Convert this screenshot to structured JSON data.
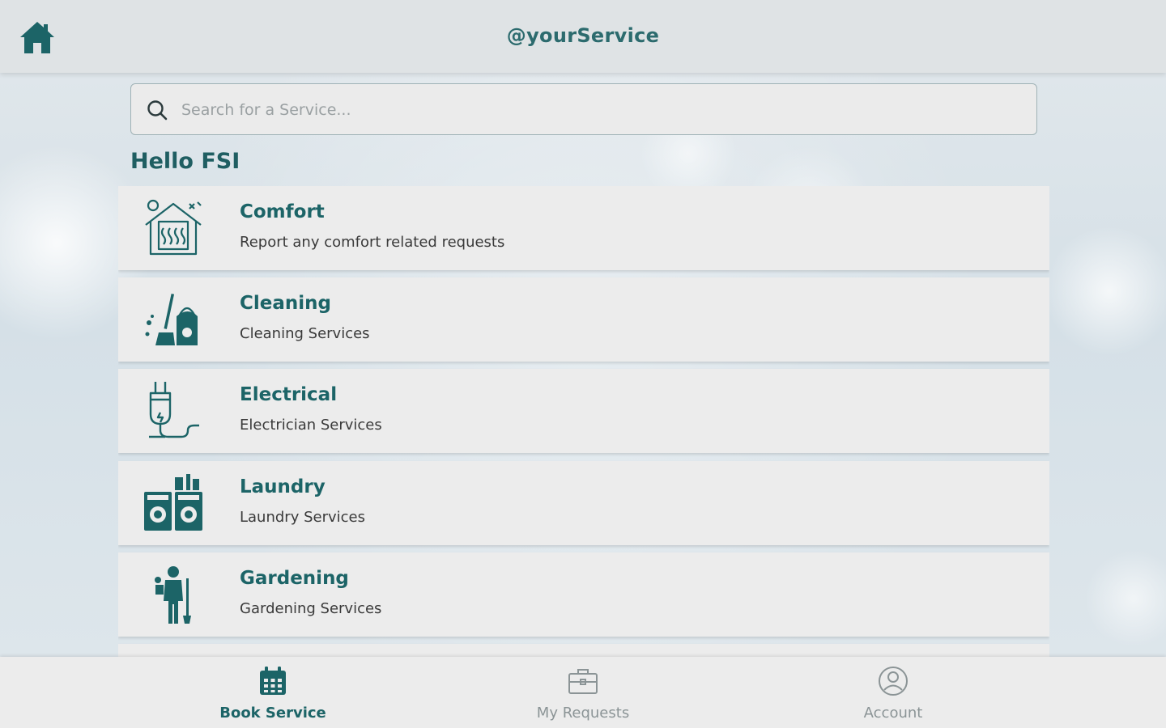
{
  "header": {
    "title": "@yourService",
    "home_icon": "home-icon"
  },
  "search": {
    "placeholder": "Search for a Service...",
    "value": "",
    "icon": "search-icon"
  },
  "greeting": "Hello FSI",
  "services": [
    {
      "title": "Comfort",
      "subtitle": "Report any comfort related requests",
      "icon": "comfort-house-icon"
    },
    {
      "title": "Cleaning",
      "subtitle": "Cleaning Services",
      "icon": "cleaning-mop-bucket-icon"
    },
    {
      "title": "Electrical",
      "subtitle": "Electrician Services",
      "icon": "electrical-plug-icon"
    },
    {
      "title": "Laundry",
      "subtitle": "Laundry Services",
      "icon": "laundry-machines-icon"
    },
    {
      "title": "Gardening",
      "subtitle": "Gardening Services",
      "icon": "gardener-icon"
    }
  ],
  "bottom_nav": [
    {
      "label": "Book Service",
      "icon": "calendar-icon",
      "active": true
    },
    {
      "label": "My Requests",
      "icon": "briefcase-icon",
      "active": false
    },
    {
      "label": "Account",
      "icon": "account-icon",
      "active": false
    }
  ],
  "colors": {
    "accent": "#1c6467",
    "header_bg": "#dfe3e5",
    "card_bg": "#ececec",
    "inactive": "#8b9496"
  }
}
